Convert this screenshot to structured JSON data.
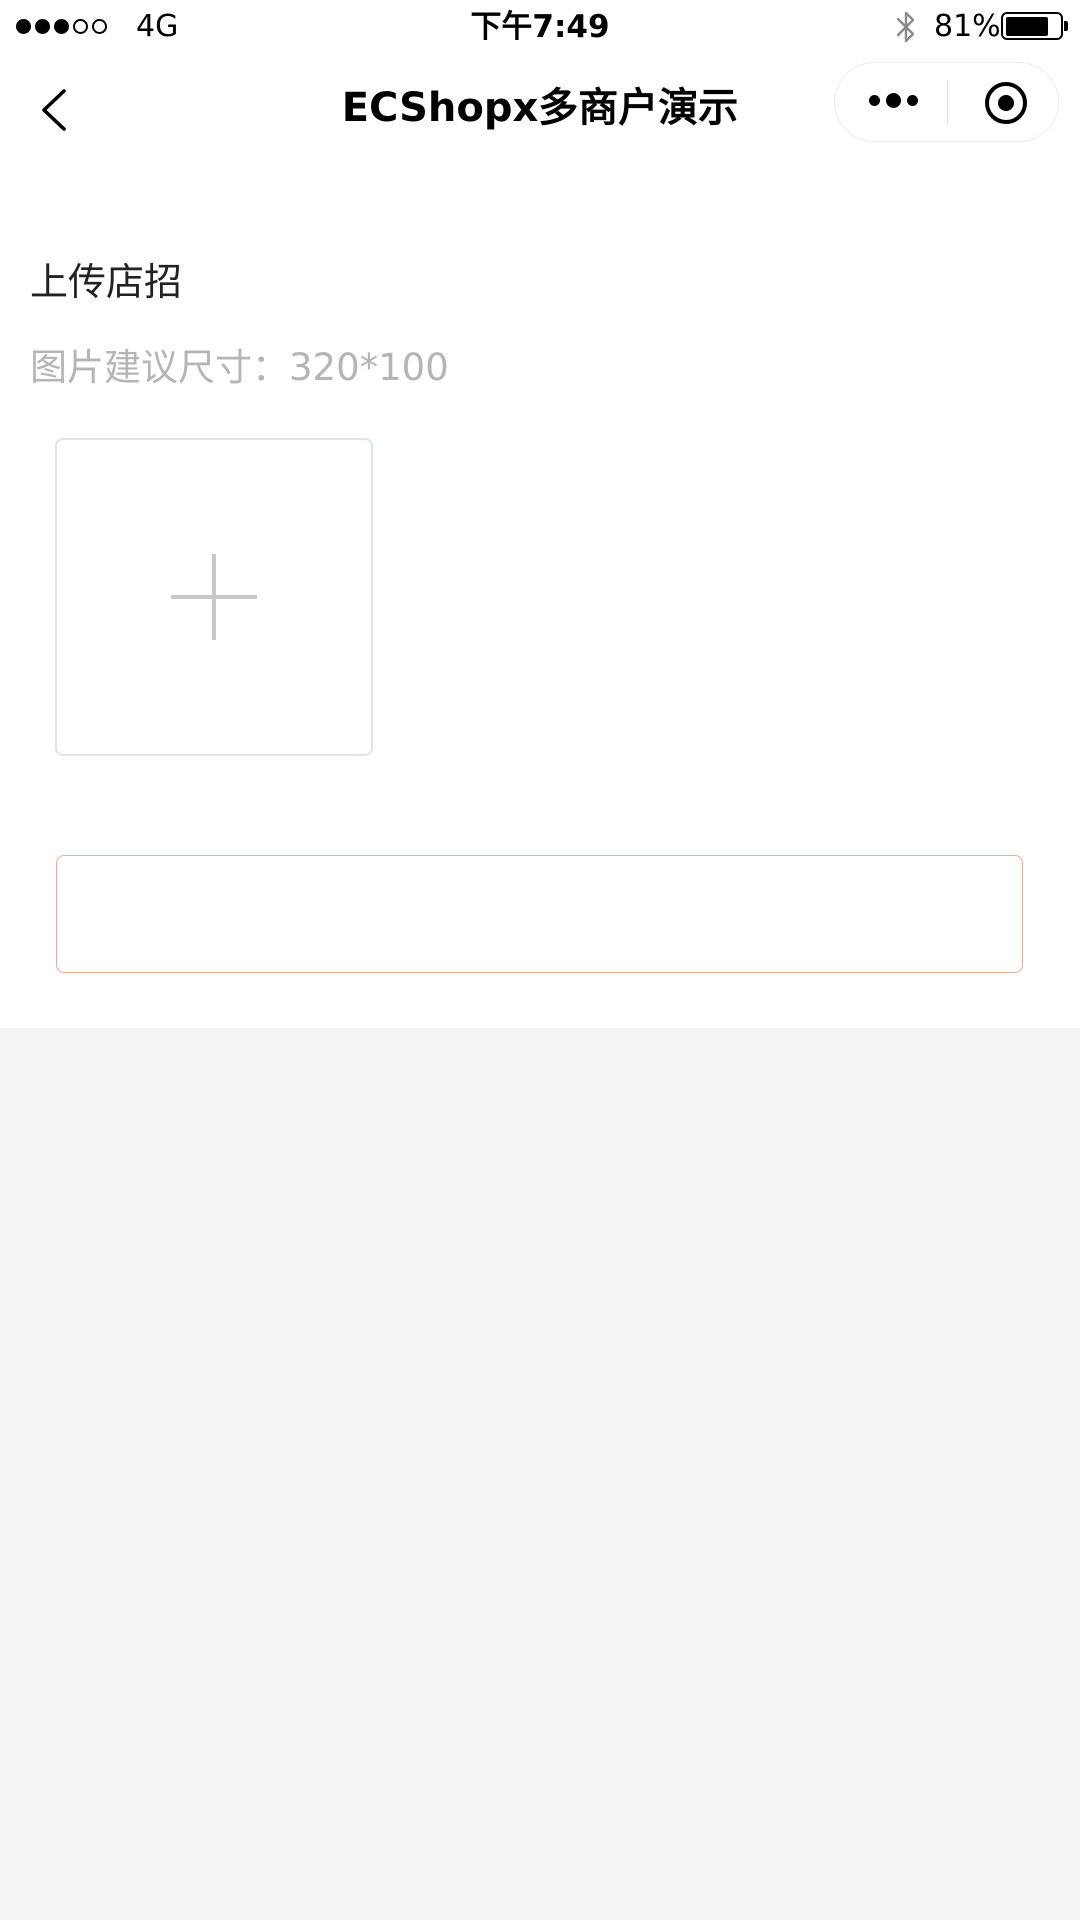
{
  "status_bar": {
    "signal_dots": [
      true,
      true,
      true,
      false,
      false
    ],
    "network": "4G",
    "time": "下午7:49",
    "battery_percent_label": "81%",
    "battery_level": 0.81
  },
  "nav": {
    "title": "ECShopx多商户演示"
  },
  "form": {
    "section_title": "上传店招",
    "size_hint": "图片建议尺寸：320*100",
    "submit_label": ""
  },
  "colors": {
    "page_background": "#f5f5f5",
    "card_background": "#ffffff",
    "hint_text": "#b5b5b5",
    "button_border": "#f3a99a",
    "upload_border": "#dfe3ea",
    "plus": "#c8c8c8"
  },
  "icons": {
    "back": "chevron-left-icon",
    "more": "more-dots-icon",
    "close": "target-circle-icon",
    "bluetooth": "bluetooth-icon",
    "upload": "plus-icon"
  }
}
